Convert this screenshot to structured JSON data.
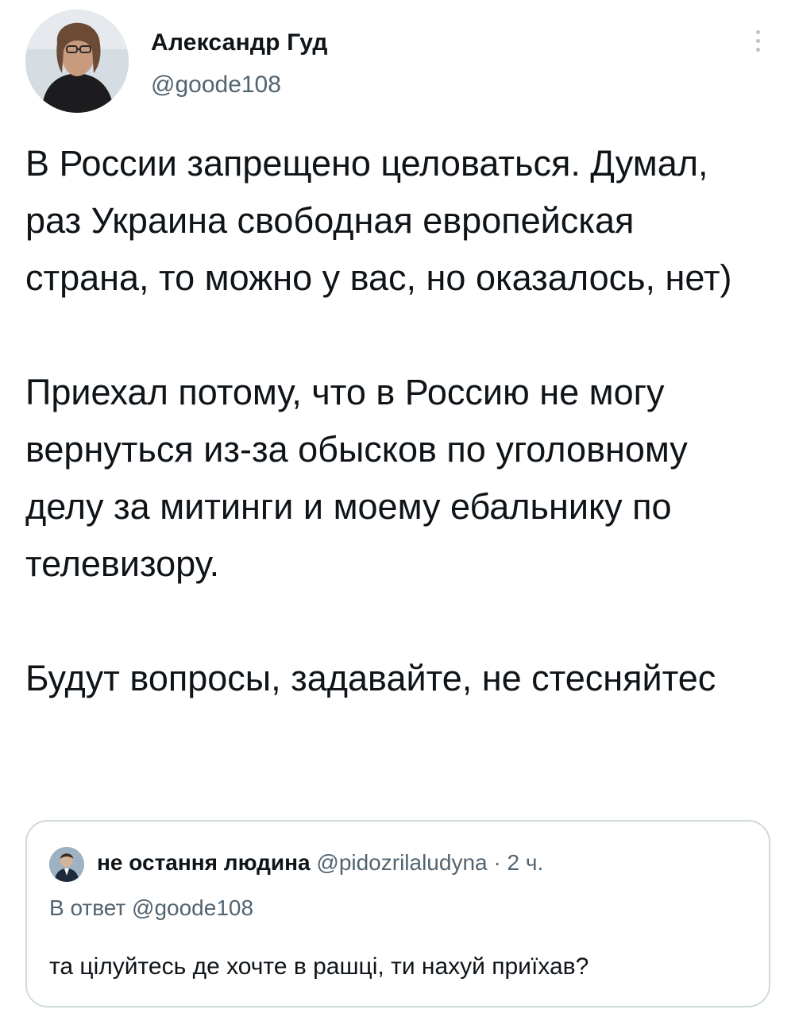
{
  "author": {
    "name": "Александр Гуд",
    "handle": "@goode108",
    "avatar_icon": "profile-photo"
  },
  "more_icon": "more-vertical-icon",
  "tweet": {
    "paragraphs": [
      "В России запрещено целоваться. Думал, раз Украина свободная европейская страна, то можно у вас, но оказалось, нет)",
      "Приехал потому, что в Россию не могу вернуться из-за обысков по уголовному делу за митинги и моему ебальнику по телевизору.",
      "Будут вопросы, задавайте, не стесняйтес"
    ]
  },
  "quoted": {
    "name": "не остання людина",
    "handle": "@pidozrilaludyna",
    "separator": "·",
    "time": "2 ч.",
    "reply_to": "В ответ @goode108",
    "text": "та цілуйтесь де хочте в рашці, ти нахуй приїхав?",
    "avatar_icon": "profile-photo"
  },
  "colors": {
    "text": "#0f1419",
    "secondary": "#536471",
    "border": "#cfd9de"
  }
}
